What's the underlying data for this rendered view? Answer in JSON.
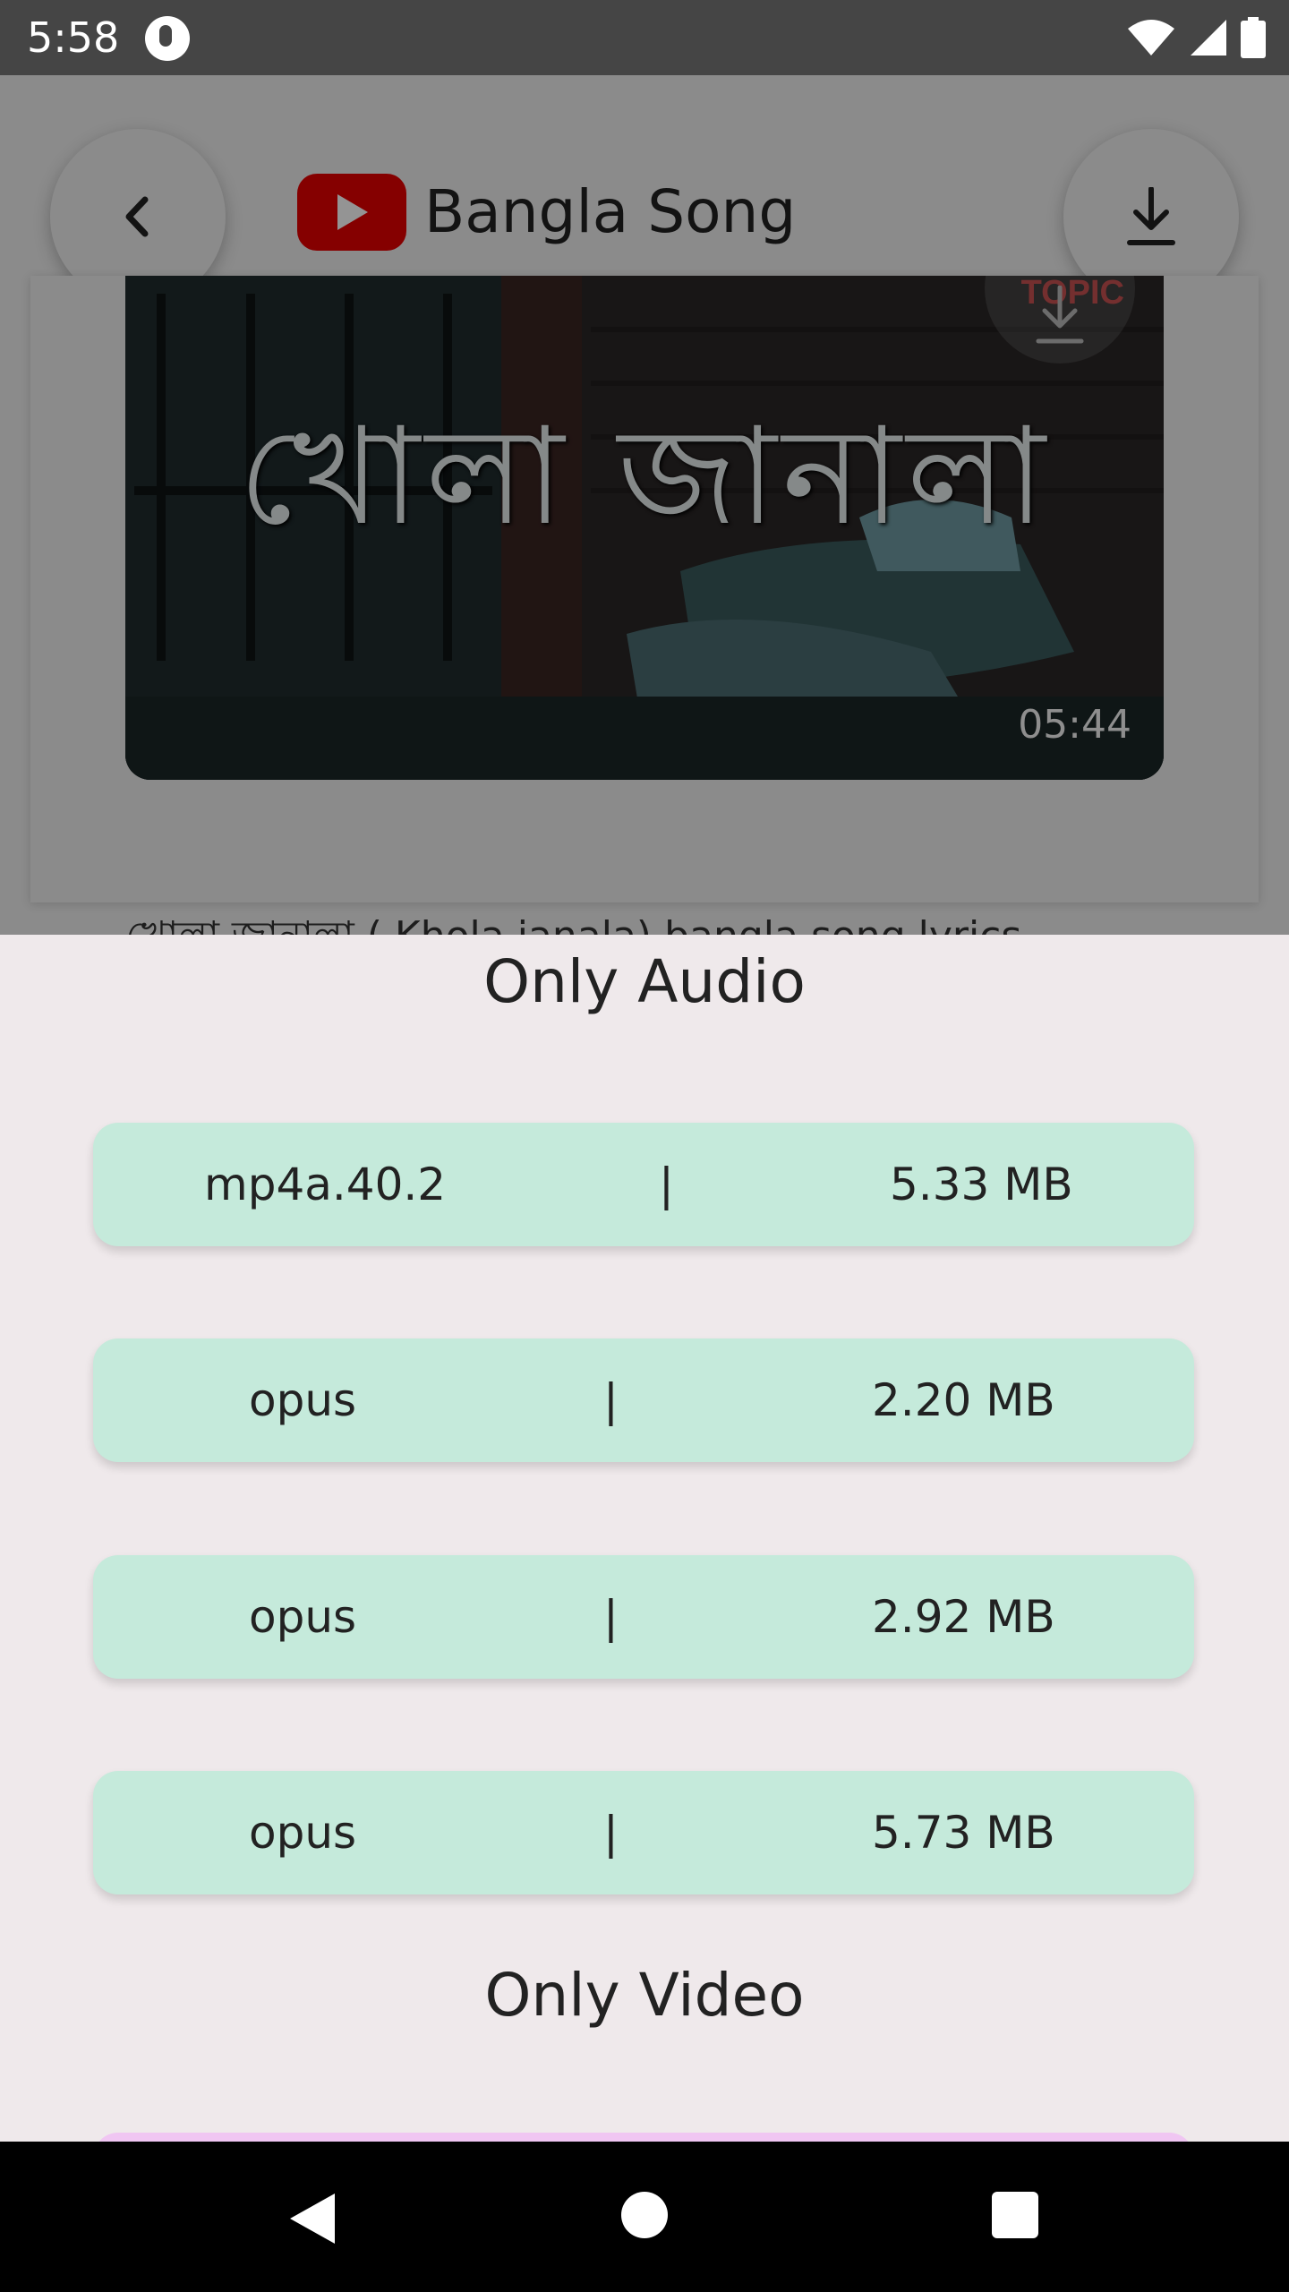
{
  "status_bar": {
    "time": "5:58",
    "icons": [
      "app-notification-icon",
      "wifi-icon",
      "cellular-signal-icon",
      "battery-icon"
    ]
  },
  "header": {
    "title": "Bangla Song",
    "back_icon": "chevron-left-icon",
    "download_icon": "download-icon",
    "logo": "youtube-logo-icon",
    "logo_color": "#e60000"
  },
  "video": {
    "thumbnail_title": "খোলা জানালা",
    "channel_badge": "TOPIC",
    "duration": "05:44",
    "description": "খোলা জানালা ( Khola janala) bangla song lyrics"
  },
  "sheet": {
    "audio_title": "Only Audio",
    "separator": "|",
    "audio_formats": [
      {
        "codec": "mp4a.40.2",
        "size": "5.33 MB"
      },
      {
        "codec": "opus",
        "size": "2.20 MB"
      },
      {
        "codec": "opus",
        "size": "2.92 MB"
      },
      {
        "codec": "opus",
        "size": "5.73 MB"
      }
    ],
    "video_title": "Only Video",
    "audio_row_color": "#c5eadb",
    "video_row_color": "#f0c6f2",
    "sheet_bg": "#efe9eb"
  },
  "nav_bar": {
    "icons": [
      "nav-back-icon",
      "nav-home-icon",
      "nav-recents-icon"
    ]
  }
}
